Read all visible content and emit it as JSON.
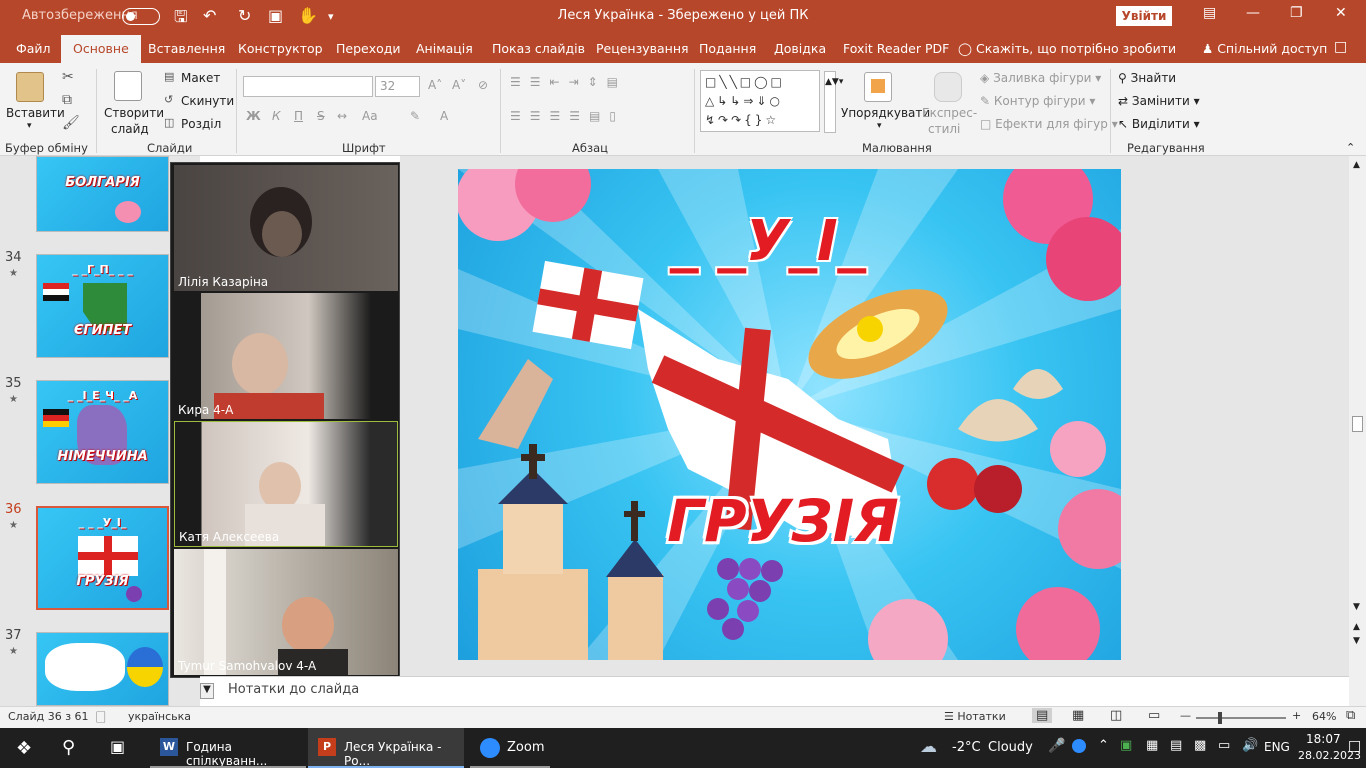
{
  "titlebar": {
    "autosave_label": "Автозбереження",
    "autosave_state": "off",
    "doc_title": "Леся Українка  -  Збережено у цей ПК",
    "signin": "Увійти"
  },
  "tabs": [
    "Файл",
    "Основне",
    "Вставлення",
    "Конструктор",
    "Переходи",
    "Анімація",
    "Показ слайдів",
    "Рецензування",
    "Подання",
    "Довідка",
    "Foxit Reader PDF"
  ],
  "tabs_active": "Основне",
  "tell_me": "Скажіть, що потрібно зробити",
  "share": "Спільний доступ",
  "ribbon": {
    "clipboard": {
      "paste": "Вставити",
      "label": "Буфер обміну"
    },
    "slides": {
      "new_slide_1": "Створити",
      "new_slide_2": "слайд",
      "layout": "Макет",
      "reset": "Скинути",
      "section": "Розділ",
      "label": "Слайди"
    },
    "font": {
      "size": "32",
      "bold": "Ж",
      "italic": "К",
      "underline": "П",
      "strike": "S",
      "label": "Шрифт"
    },
    "paragraph": {
      "label": "Абзац"
    },
    "drawing": {
      "arrange_1": "Упорядкувати",
      "quick_styles_1": "Експрес-",
      "quick_styles_2": "стилі",
      "fill": "Заливка фігури",
      "outline": "Контур фігури",
      "effects": "Ефекти для фігур",
      "label": "Малювання"
    },
    "editing": {
      "find": "Знайти",
      "replace": "Замінити",
      "select": "Виділити",
      "label": "Редагування"
    }
  },
  "thumbnails": [
    {
      "num": "",
      "caption": "БОЛГАРІЯ",
      "top": ""
    },
    {
      "num": "34",
      "caption": "ЄГИПЕТ",
      "top": "_ _Г_П_ _ _"
    },
    {
      "num": "35",
      "caption": "НІМЕЧЧИНА",
      "top": "_ _І_Е_Ч_ _А"
    },
    {
      "num": "36",
      "caption": "ГРУЗІЯ",
      "top": "_ _ _У_І_"
    },
    {
      "num": "37",
      "caption": "",
      "top": ""
    }
  ],
  "zoom_participants": [
    "Лілія Казаріна",
    "Кира 4-А",
    "Катя Алексеева",
    "Tymur Samohvalov 4-A"
  ],
  "slide": {
    "puzzle": "_ _У_І_",
    "country": "ГРУЗІЯ"
  },
  "notes_label": "Нотатки до слайда",
  "status": {
    "slide_count": "Слайд 36 з 61",
    "language": "українська",
    "notes_btn": "Нотатки",
    "zoom_level": "64%"
  },
  "taskbar": {
    "word": "Година спілкуванн...",
    "ppt": "Леся Українка - Ро...",
    "zoom": "Zoom",
    "weather_temp": "-2°C",
    "weather_desc": "Cloudy",
    "lang": "ENG",
    "time": "18:07",
    "date": "28.02.2023"
  }
}
